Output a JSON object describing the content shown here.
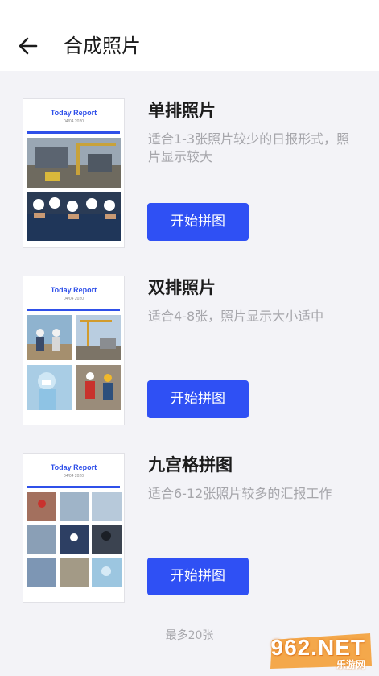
{
  "header": {
    "title": "合成照片",
    "back_icon": "arrow-left-icon"
  },
  "report": {
    "title": "Today Report",
    "date": "04/04 2020"
  },
  "cards": [
    {
      "title": "单排照片",
      "desc": "适合1-3张照片较少的日报形式，照片显示较大",
      "button": "开始拼图"
    },
    {
      "title": "双排照片",
      "desc": "适合4-8张，照片显示大小适中",
      "button": "开始拼图"
    },
    {
      "title": "九宫格拼图",
      "desc": "适合6-12张照片较多的汇报工作",
      "button": "开始拼图"
    }
  ],
  "footer": {
    "note": "最多20张"
  },
  "watermark": {
    "text": "962.NET",
    "sub": "乐游网"
  },
  "colors": {
    "accent": "#2f50f4",
    "background": "#f3f3f7"
  }
}
